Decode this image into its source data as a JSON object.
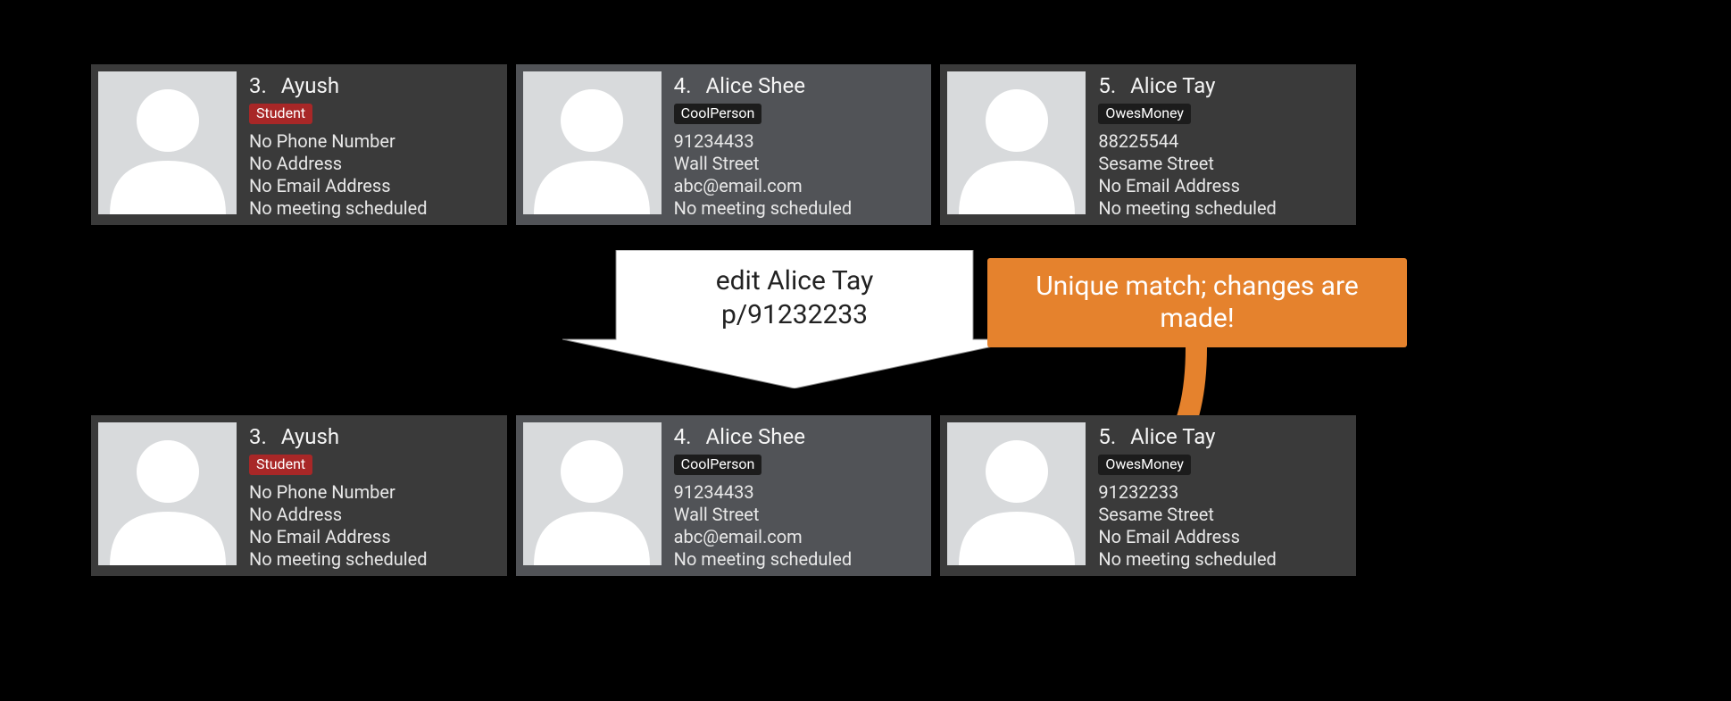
{
  "before": [
    {
      "idx": "3.",
      "name": "Ayush",
      "tag": "Student",
      "tag_style": "red",
      "phone": "No Phone Number",
      "address": "No Address",
      "email": "No Email Address",
      "meeting": "No meeting scheduled",
      "alt": false
    },
    {
      "idx": "4.",
      "name": "Alice Shee",
      "tag": "CoolPerson",
      "tag_style": "black",
      "phone": "91234433",
      "address": "Wall Street",
      "email": "abc@email.com",
      "meeting": "No meeting scheduled",
      "alt": true
    },
    {
      "idx": "5.",
      "name": "Alice Tay",
      "tag": "OwesMoney",
      "tag_style": "black",
      "phone": "88225544",
      "address": "Sesame Street",
      "email": "No Email Address",
      "meeting": "No meeting scheduled",
      "alt": false
    }
  ],
  "after": [
    {
      "idx": "3.",
      "name": "Ayush",
      "tag": "Student",
      "tag_style": "red",
      "phone": "No Phone Number",
      "address": "No Address",
      "email": "No Email Address",
      "meeting": "No meeting scheduled",
      "alt": false
    },
    {
      "idx": "4.",
      "name": "Alice Shee",
      "tag": "CoolPerson",
      "tag_style": "black",
      "phone": "91234433",
      "address": "Wall Street",
      "email": "abc@email.com",
      "meeting": "No meeting scheduled",
      "alt": true
    },
    {
      "idx": "5.",
      "name": "Alice Tay",
      "tag": "OwesMoney",
      "tag_style": "black",
      "phone": "91232233",
      "address": "Sesame Street",
      "email": "No Email Address",
      "meeting": "No meeting scheduled",
      "alt": false
    }
  ],
  "command": {
    "line1": "edit Alice Tay",
    "line2": "p/91232233"
  },
  "callout": {
    "line1": "Unique match; changes are",
    "line2": "made!"
  },
  "colors": {
    "card": "#3a3a3a",
    "cardAlt": "#515357",
    "avatar": "#d8dadc",
    "tagRed": "#a82727",
    "tagBlk": "#1c1c1c",
    "orange": "#e5822d"
  }
}
